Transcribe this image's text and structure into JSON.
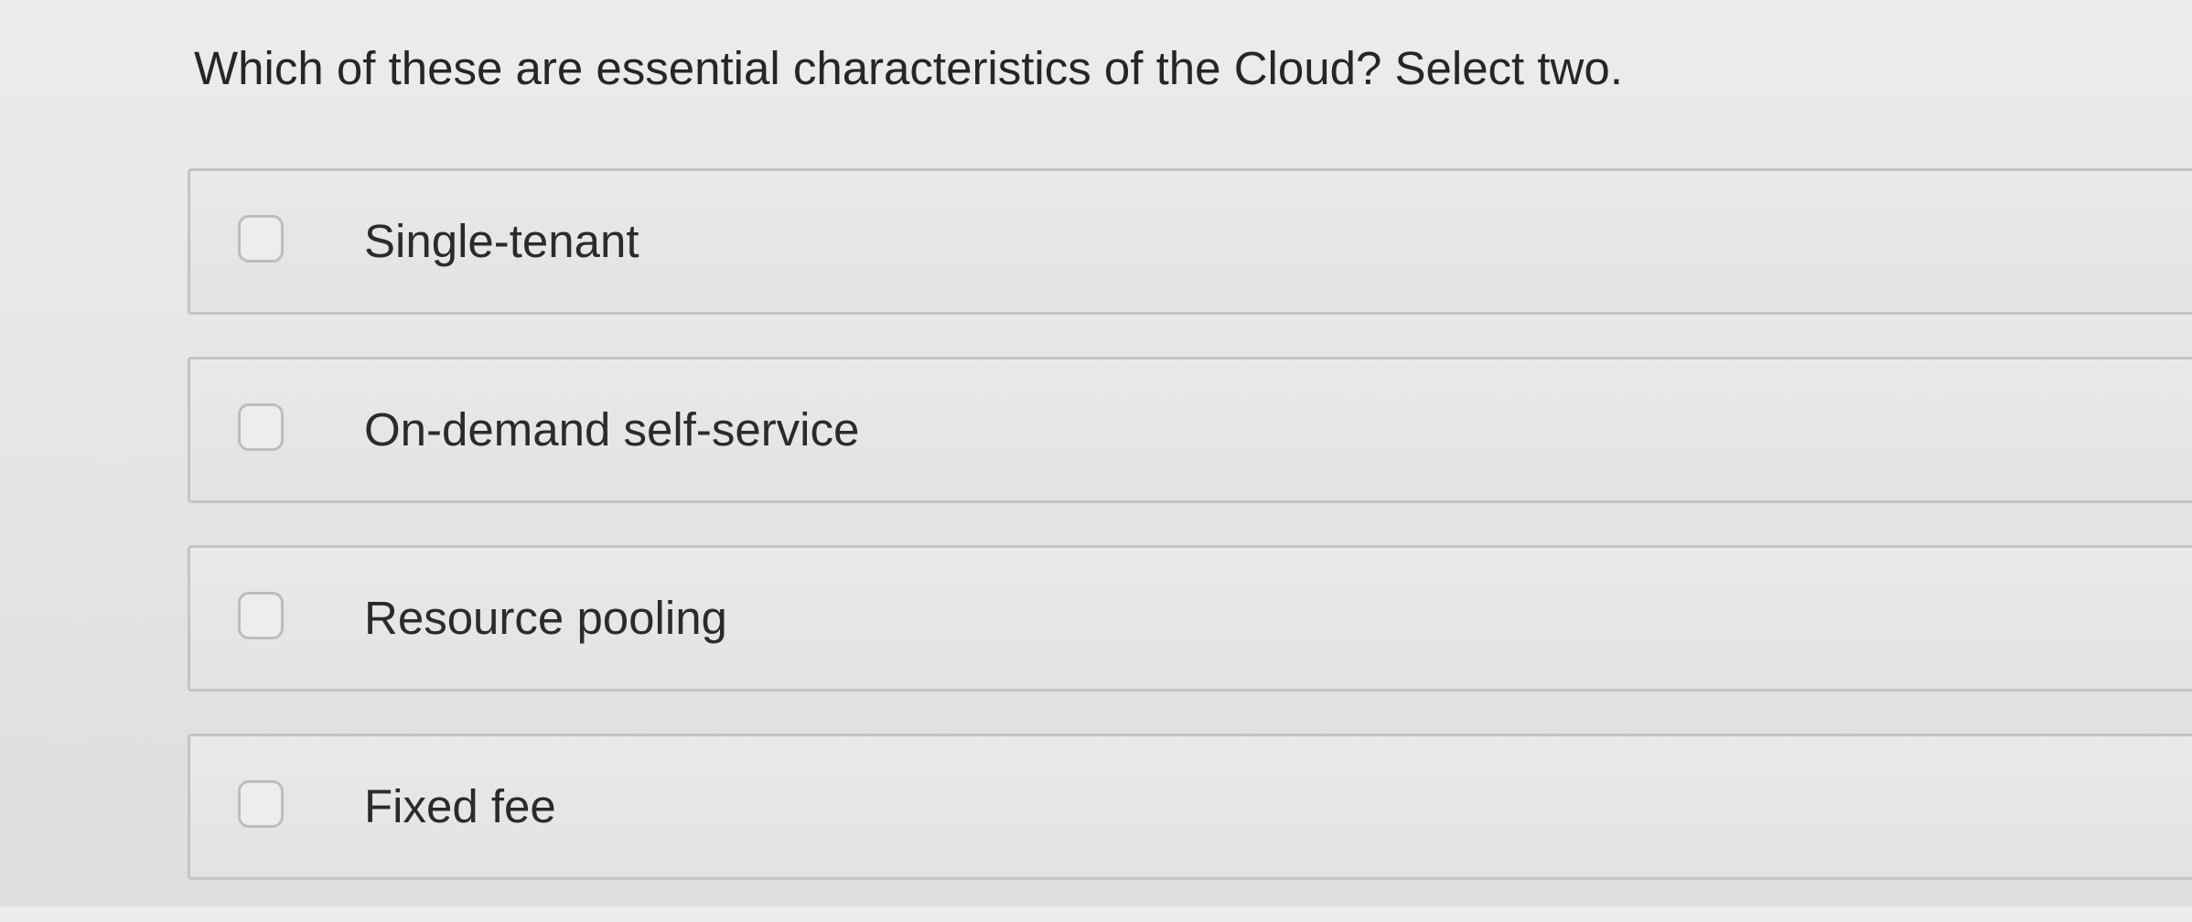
{
  "question": {
    "text": "Which of these are essential characteristics of the Cloud? Select two."
  },
  "options": [
    {
      "label": "Single-tenant",
      "checked": false
    },
    {
      "label": "On-demand self-service",
      "checked": false
    },
    {
      "label": "Resource pooling",
      "checked": false
    },
    {
      "label": "Fixed fee",
      "checked": false
    }
  ]
}
